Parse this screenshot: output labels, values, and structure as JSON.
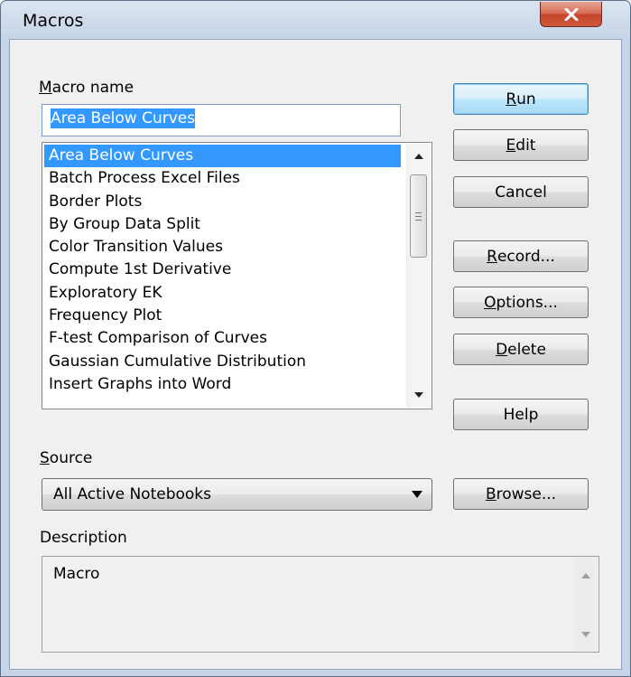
{
  "window": {
    "title": "Macros"
  },
  "labels": {
    "macro_name_prefix": "M",
    "macro_name_rest": "acro name",
    "source_prefix": "S",
    "source_rest": "ource",
    "description": "Description"
  },
  "macro_name_input": {
    "value": "Area Below Curves"
  },
  "macro_list": {
    "items": [
      "Area Below Curves",
      "Batch Process Excel Files",
      "Border Plots",
      "By Group Data Split",
      "Color Transition Values",
      "Compute 1st Derivative",
      "Exploratory EK",
      "Frequency Plot",
      "F-test Comparison of Curves",
      "Gaussian Cumulative Distribution",
      "Insert Graphs into Word"
    ],
    "selected_index": 0
  },
  "buttons": {
    "run_prefix": "R",
    "run_rest": "un",
    "edit_prefix": "E",
    "edit_rest": "dit",
    "cancel": "Cancel",
    "record_prefix": "R",
    "record_rest": "ecord...",
    "options_prefix": "O",
    "options_rest": "ptions...",
    "delete_prefix": "D",
    "delete_rest": "elete",
    "help": "Help",
    "browse_prefix": "B",
    "browse_rest": "rowse..."
  },
  "source": {
    "selected": "All Active Notebooks"
  },
  "description": {
    "text": "Macro"
  },
  "colors": {
    "selection": "#3399ff",
    "close_button": "#c7432a",
    "window_frame": "#c6d4e6",
    "dialog_bg": "#f0f0f0"
  },
  "icons": {
    "close": "close-x-icon",
    "scroll_up": "scroll-up-arrow-icon",
    "scroll_down": "scroll-down-arrow-icon",
    "dropdown": "dropdown-arrow-icon"
  }
}
